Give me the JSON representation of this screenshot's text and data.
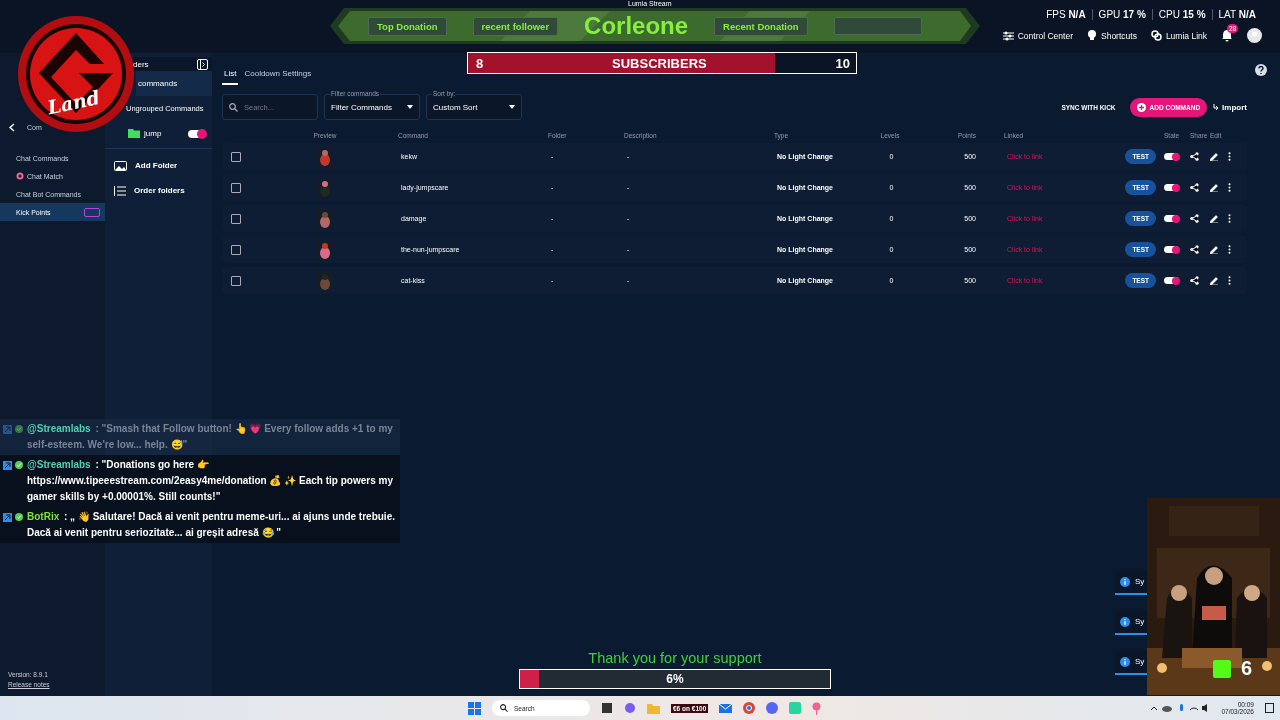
{
  "window": {
    "title": "Lumia Stream"
  },
  "topbar": {
    "stats": [
      {
        "label": "FPS",
        "value": "N/A"
      },
      {
        "label": "GPU",
        "value": "17 %"
      },
      {
        "label": "CPU",
        "value": "15 %"
      },
      {
        "label": "LAT",
        "value": "N/A"
      }
    ],
    "links": [
      {
        "kind": "control",
        "label": "Control Center"
      },
      {
        "kind": "shortcuts",
        "label": "Shortcuts"
      },
      {
        "kind": "link",
        "label": "Lumia Link"
      }
    ],
    "notifications": "28"
  },
  "nav": {
    "back": "Com",
    "items": [
      {
        "label": "Chat Commands",
        "selected": false,
        "kind": "plain"
      },
      {
        "label": "Chat Match",
        "selected": false,
        "kind": "match"
      },
      {
        "label": "Chat Bot Commands",
        "selected": false,
        "kind": "plain"
      },
      {
        "label": "Kick Points",
        "selected": true,
        "kind": "new"
      }
    ],
    "version": "Version: 8.9.1",
    "release_notes": "Release notes"
  },
  "folders": {
    "header": "ders",
    "items": [
      {
        "label": "commands",
        "selected": true,
        "kind": "group"
      },
      {
        "label": "Ungrouped Commands",
        "selected": false,
        "kind": "group"
      },
      {
        "label": "jump",
        "selected": false,
        "kind": "folder",
        "on": true
      }
    ],
    "actions": [
      {
        "kind": "add",
        "label": "Add Folder"
      },
      {
        "kind": "order",
        "label": "Order folders"
      }
    ]
  },
  "main": {
    "tabs": [
      {
        "label": "List",
        "selected": true
      },
      {
        "label": "Cooldown Settings",
        "selected": false
      }
    ],
    "search": {
      "placeholder": "Search..."
    },
    "filter": {
      "label": "Filter commands",
      "value": "Filter Commands"
    },
    "sort": {
      "label": "Sort by:",
      "value": "Custom Sort"
    },
    "sync": "SYNC WITH KICK",
    "add": "ADD COMMAND",
    "import": "Import",
    "table": {
      "columns": [
        "Preview",
        "Command",
        "Folder",
        "Description",
        "Type",
        "Levels",
        "Points",
        "Linked",
        "State",
        "Share",
        "Edit"
      ],
      "rows": [
        {
          "checked": false,
          "command": "kekw",
          "folder": "-",
          "description": "-",
          "type": "No Light Change",
          "levels": "0",
          "points": "500",
          "linked": "Click to link",
          "test": "TEST",
          "on": true
        },
        {
          "checked": false,
          "command": "lady-jumpscare",
          "folder": "-",
          "description": "-",
          "type": "No Light Change",
          "levels": "0",
          "points": "500",
          "linked": "Click to link",
          "test": "TEST",
          "on": true
        },
        {
          "checked": false,
          "command": "damage",
          "folder": "-",
          "description": "-",
          "type": "No Light Change",
          "levels": "0",
          "points": "500",
          "linked": "Click to link",
          "test": "TEST",
          "on": true
        },
        {
          "checked": false,
          "command": "the-nun-jumpscare",
          "folder": "-",
          "description": "-",
          "type": "No Light Change",
          "levels": "0",
          "points": "500",
          "linked": "Click to link",
          "test": "TEST",
          "on": true
        },
        {
          "checked": false,
          "command": "cat-kiss",
          "folder": "-",
          "description": "-",
          "type": "No Light Change",
          "levels": "0",
          "points": "500",
          "linked": "Click to link",
          "test": "TEST",
          "on": true
        }
      ]
    }
  },
  "logo": {
    "text": "Land"
  },
  "banner": {
    "title": "Corleone",
    "slots": [
      "Top Donation",
      "recent follower",
      "Recent Donation"
    ]
  },
  "subscribers": {
    "current": "8",
    "label": "SUBSCRIBERS",
    "goal": "10",
    "level": 0.79
  },
  "chat": [
    {
      "user": "@Streamlabs",
      "text": ": \"Smash that Follow button! 👆 💗 Every follow adds +1 to my self-esteem. We're low... help. 😅\"",
      "faded": true,
      "color": "#4fd1b5"
    },
    {
      "user": "@Streamlabs",
      "text": ": \"Donations go here 👉 https://www.tipeeestream.com/2easy4me/donation 💰 ✨ Each tip powers my gamer skills by +0.00001%. Still counts!\"",
      "faded": false,
      "color": "#4fd1b5"
    },
    {
      "user": "BotRix",
      "text": ": „ 👋 Salutare! Dacă ai venit pentru meme-uri... ai ajuns unde trebuie. Dacă ai venit pentru seriozitate... ai greșit adresă 😂 \"",
      "faded": false,
      "color": "#7ee03a"
    }
  ],
  "toasts": [
    "Sy",
    "Sy",
    "Sy"
  ],
  "giveaway": {
    "count": "6"
  },
  "support": {
    "title": "Thank you for your support",
    "level": 0.06,
    "reading": "6%"
  },
  "taskbar": {
    "search": "Search",
    "promo": "€6 on €100",
    "time": "00:09",
    "date": "07/03/2026"
  }
}
